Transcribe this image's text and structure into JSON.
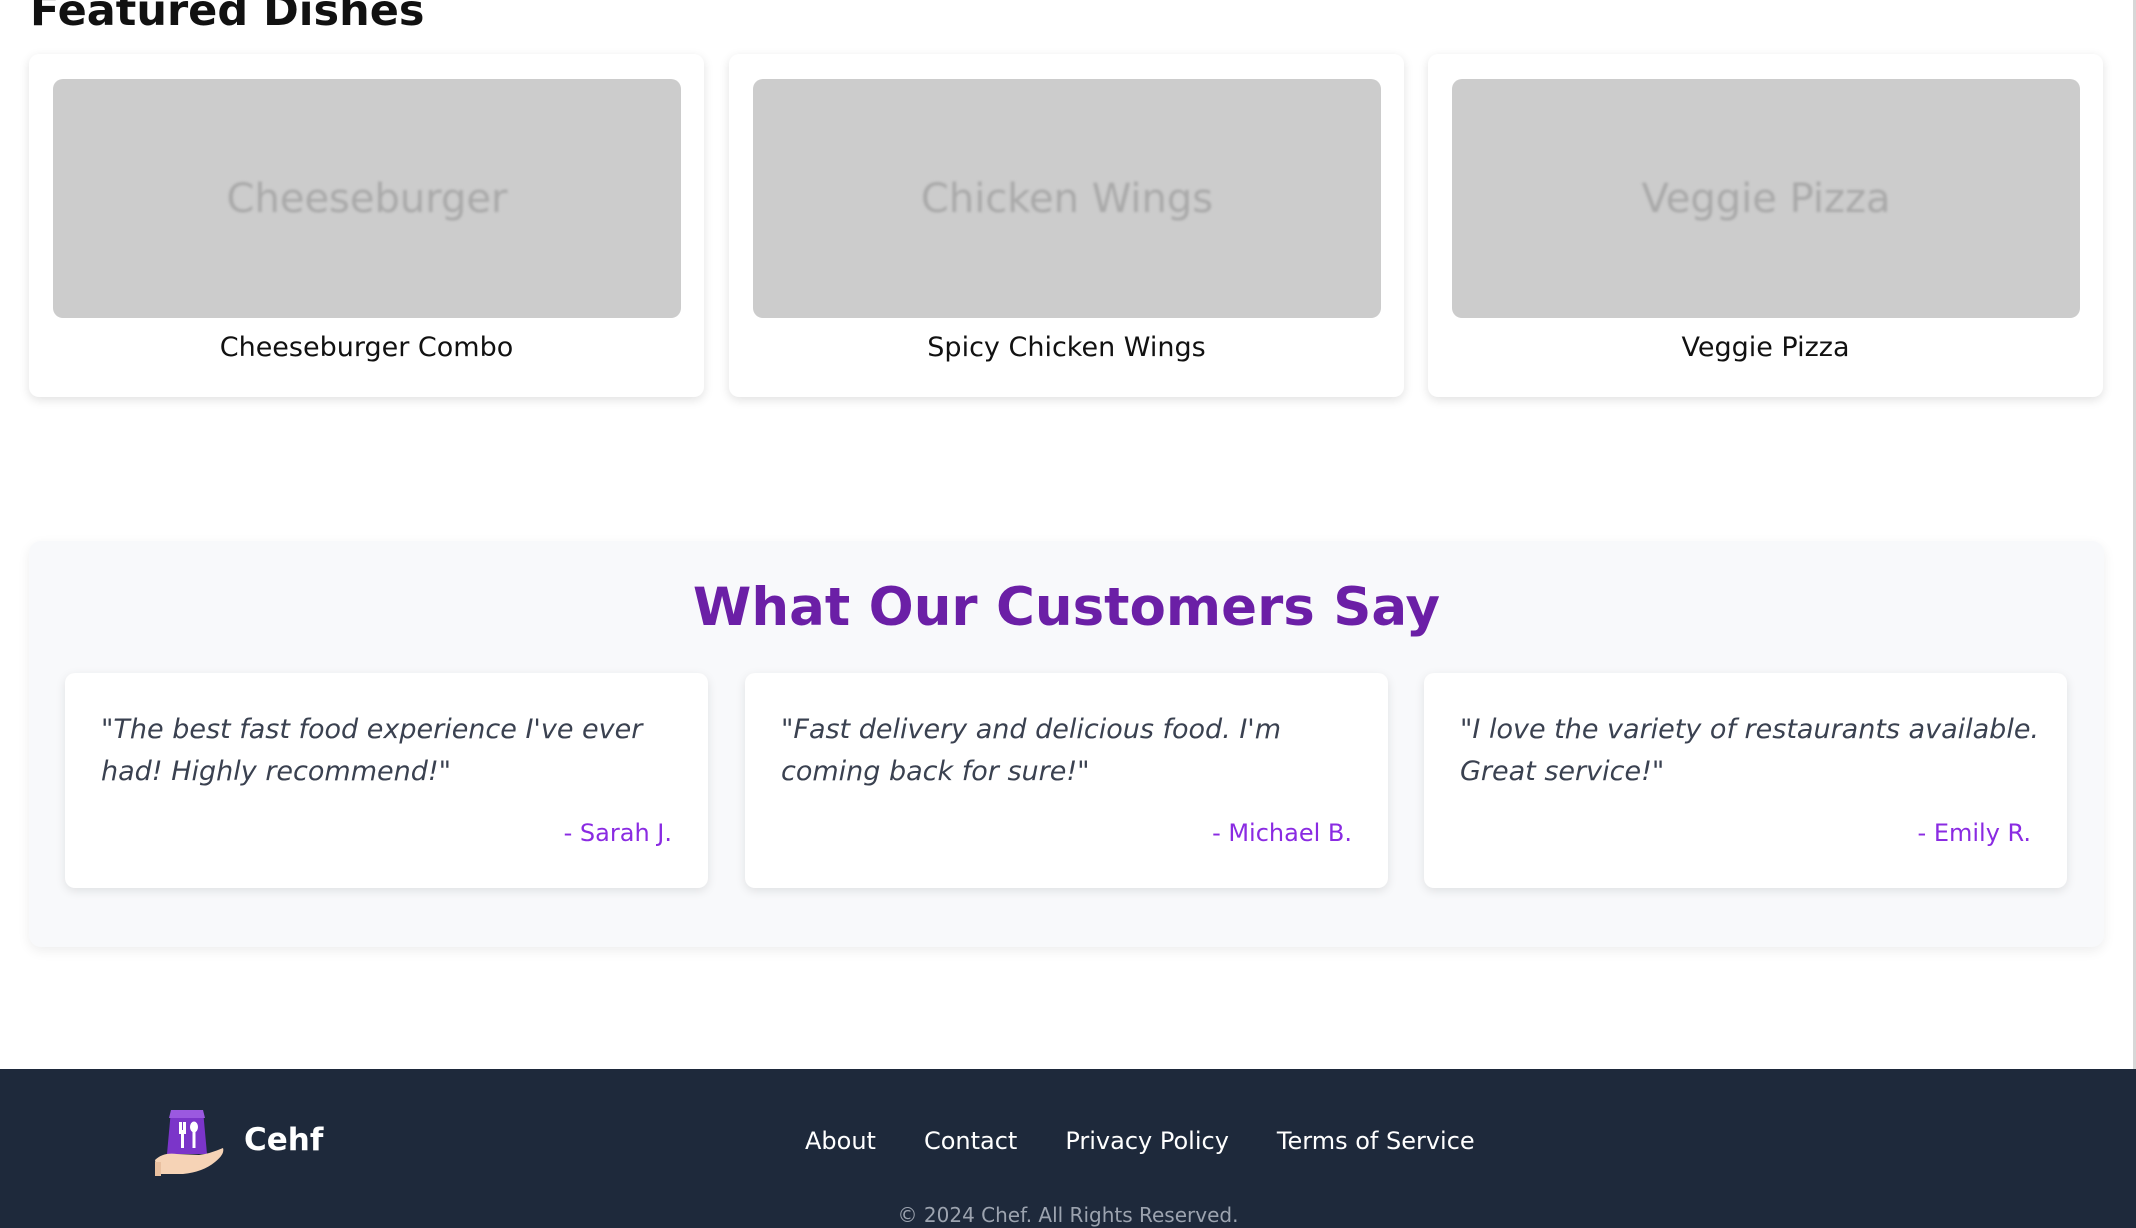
{
  "featured": {
    "title": "Featured Dishes",
    "dishes": [
      {
        "image_text": "Cheeseburger",
        "name": "Cheeseburger Combo"
      },
      {
        "image_text": "Chicken Wings",
        "name": "Spicy Chicken Wings"
      },
      {
        "image_text": "Veggie Pizza",
        "name": "Veggie Pizza"
      }
    ]
  },
  "testimonials": {
    "title": "What Our Customers Say",
    "items": [
      {
        "quote": "\"The best fast food experience I've ever had! Highly recommend!\"",
        "author": "- Sarah J."
      },
      {
        "quote": "\"Fast delivery and delicious food. I'm coming back for sure!\"",
        "author": "- Michael B."
      },
      {
        "quote": "\"I love the variety of restaurants available. Great service!\"",
        "author": "- Emily R."
      }
    ]
  },
  "footer": {
    "logo_icon": "hand-holding-bag-fork-spoon-icon",
    "brand": "Cehf",
    "links": [
      "About",
      "Contact",
      "Privacy Policy",
      "Terms of Service"
    ],
    "copyright": "© 2024 Chef. All Rights Reserved."
  },
  "colors": {
    "accent": "#6b1fa6",
    "author": "#8a2be2",
    "footer_bg": "#1e293b",
    "placeholder_bg": "#cccccc"
  }
}
